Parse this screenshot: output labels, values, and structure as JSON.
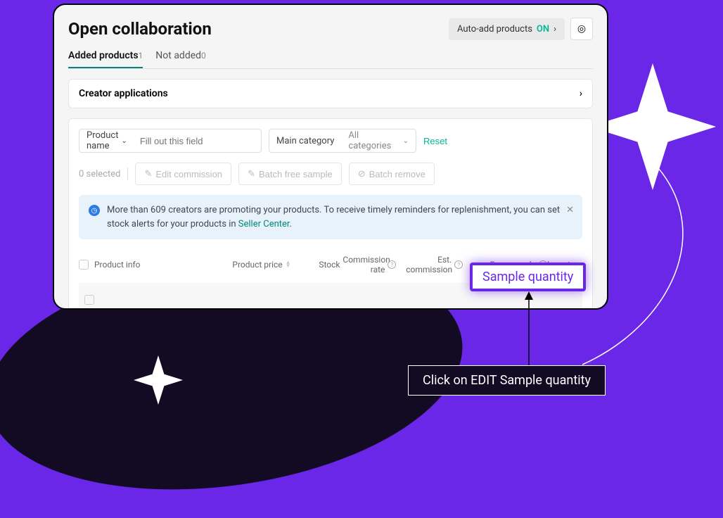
{
  "header": {
    "title": "Open collaboration",
    "autoadd_label": "Auto-add products",
    "autoadd_status": "ON"
  },
  "tabs": [
    {
      "label": "Added products",
      "count": "1"
    },
    {
      "label": "Not added",
      "count": "0"
    }
  ],
  "section": {
    "title": "Creator applications"
  },
  "filters": {
    "product_label": "Product name",
    "search_placeholder": "Fill out this field",
    "category_label": "Main category",
    "category_value": "All categories",
    "reset": "Reset"
  },
  "batch": {
    "selected": "0 selected",
    "edit_commission": "Edit commission",
    "batch_free_sample": "Batch free sample",
    "batch_remove": "Batch remove"
  },
  "banner": {
    "text_before": "More than 609 creators are promoting your products. To receive timely reminders for replenishment, you can set stock alerts for your products in ",
    "link": "Seller Center",
    "text_after": "."
  },
  "columns": {
    "product_info": "Product info",
    "product_price": "Product price",
    "stock": "Stock",
    "commission_rate": "Commission rate",
    "est_commission": "Est. commission",
    "free_sample": "Free sample",
    "approved_creators": "Approved creators"
  },
  "callout": "Sample quantity",
  "tooltip": "Click on EDIT Sample quantity"
}
